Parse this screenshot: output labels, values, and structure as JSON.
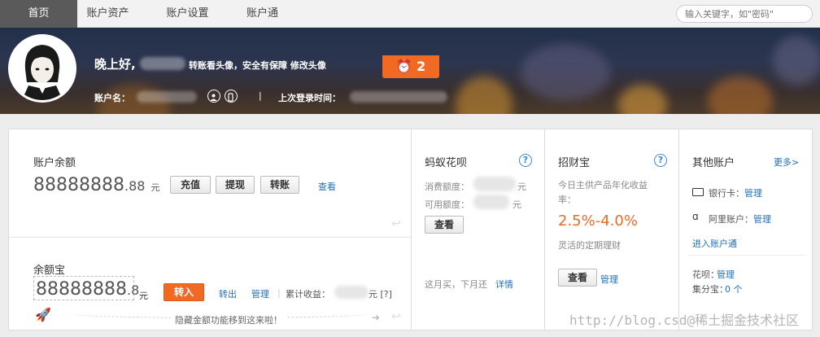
{
  "nav": {
    "tabs": [
      {
        "label": "首页"
      },
      {
        "label": "账户资产"
      },
      {
        "label": "账户设置"
      },
      {
        "label": "账户通"
      }
    ],
    "search_placeholder": "输入关键字，如\"密码\""
  },
  "banner": {
    "alarm_count": "2",
    "greeting": "晚上好,",
    "greeting_sub": "转账看头像，安全有保障 修改头像",
    "account_label": "账户名：",
    "separator": "|",
    "last_login_label": "上次登录时间："
  },
  "balance": {
    "title": "账户余额",
    "amount_int": "88888888",
    "amount_dec": ".88",
    "unit": "元",
    "btn_recharge": "充值",
    "btn_withdraw": "提现",
    "btn_transfer": "转账",
    "view_link": "查看"
  },
  "yuebao": {
    "title": "余额宝",
    "amount_int": "88888888",
    "amount_dec": ".8",
    "unit": "元",
    "btn_in": "转入",
    "link_out": "转出",
    "link_manage": "管理",
    "divider": "|",
    "cumulative_label": "累计收益：",
    "cumulative_unit": "元 [?]",
    "hint": "隐藏金额功能移到这来啦！"
  },
  "huabei": {
    "title": "蚂蚁花呗",
    "consumption_label": "消费额度：",
    "available_label": "可用额度：",
    "unit": "元",
    "btn_view": "查看",
    "footer_text": "这月买，下月还",
    "footer_link": "详情"
  },
  "zhaocaibao": {
    "title": "招财宝",
    "desc": "今日主供产品年化收益率：",
    "rate": "2.5%-4.0%",
    "sub": "灵活的定期理财",
    "btn_view": "查看",
    "link_manage": "管理"
  },
  "other": {
    "title": "其他账户",
    "more_link": "更多>",
    "bank_label": "银行卡：",
    "bank_manage": "管理",
    "ali_label": "阿里账户：",
    "ali_manage": "管理",
    "enter_link": "进入账户通",
    "huabei_label": "花呗：",
    "huabei_manage": "管理",
    "jifen_label": "集分宝：",
    "jifen_value": "0 个"
  },
  "watermark": "http://blog.csd@稀土掘金技术社区",
  "colors": {
    "accent": "#f06a24",
    "link": "#1f6fb5",
    "rate": "#f06a24"
  }
}
